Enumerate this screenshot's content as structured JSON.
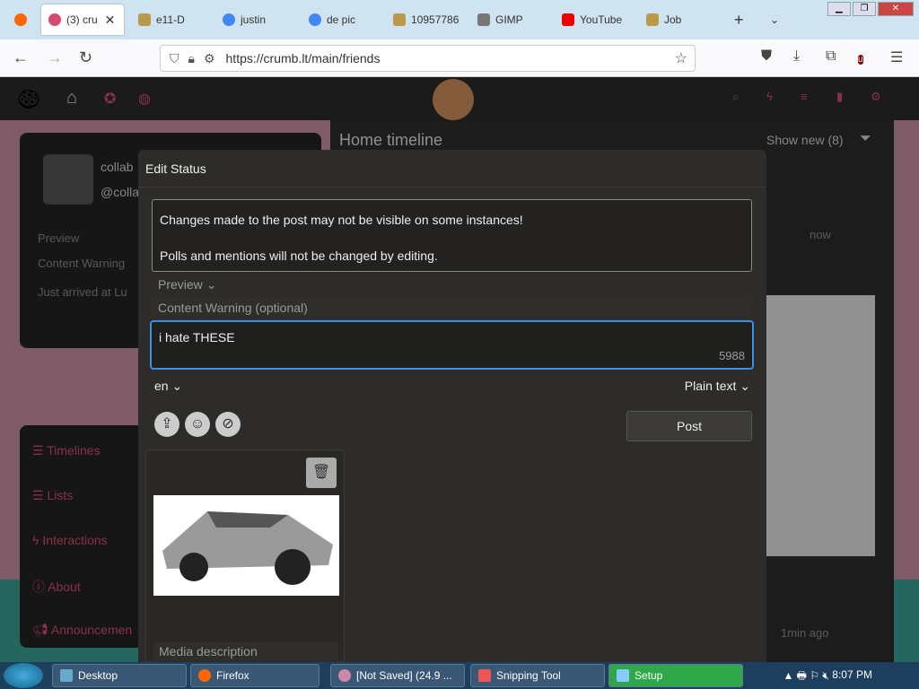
{
  "browser": {
    "tabs": [
      {
        "label": "(3) cru",
        "active": true
      },
      {
        "label": "e11-D",
        "active": false
      },
      {
        "label": "justin",
        "active": false
      },
      {
        "label": "de pic",
        "active": false
      },
      {
        "label": "10957786",
        "active": false
      },
      {
        "label": "GIMP",
        "active": false
      },
      {
        "label": "YouTube",
        "active": false
      },
      {
        "label": "Job",
        "active": false
      }
    ],
    "url": "https://crumb.lt/main/friends"
  },
  "page": {
    "timeline_title": "Home timeline",
    "show_new": "Show new (8)",
    "timestamp_now": "now",
    "timestamp_1min": "1min ago",
    "user_name": "collab",
    "user_handle": "@colla",
    "left_preview": "Preview",
    "left_cw": "Content Warning",
    "left_status": "Just arrived at Lu",
    "nav": [
      "Timelines",
      "Lists",
      "Interactions",
      "About",
      "Announcemen"
    ]
  },
  "modal": {
    "title": "Edit Status",
    "notice_line1": "Changes made to the post may not be visible on some instances!",
    "notice_line2": "Polls and mentions will not be changed by editing.",
    "preview_label": "Preview",
    "cw_placeholder": "Content Warning (optional)",
    "status_text": "i hate THESE",
    "char_count": "5988",
    "language": "en",
    "format": "Plain text",
    "post_label": "Post",
    "media_description_placeholder": "Media description"
  },
  "taskbar": {
    "items": [
      "Desktop",
      "Firefox",
      "[Not Saved] (24.9 ...",
      "Snipping Tool",
      "Setup"
    ],
    "clock": "8:07 PM"
  }
}
